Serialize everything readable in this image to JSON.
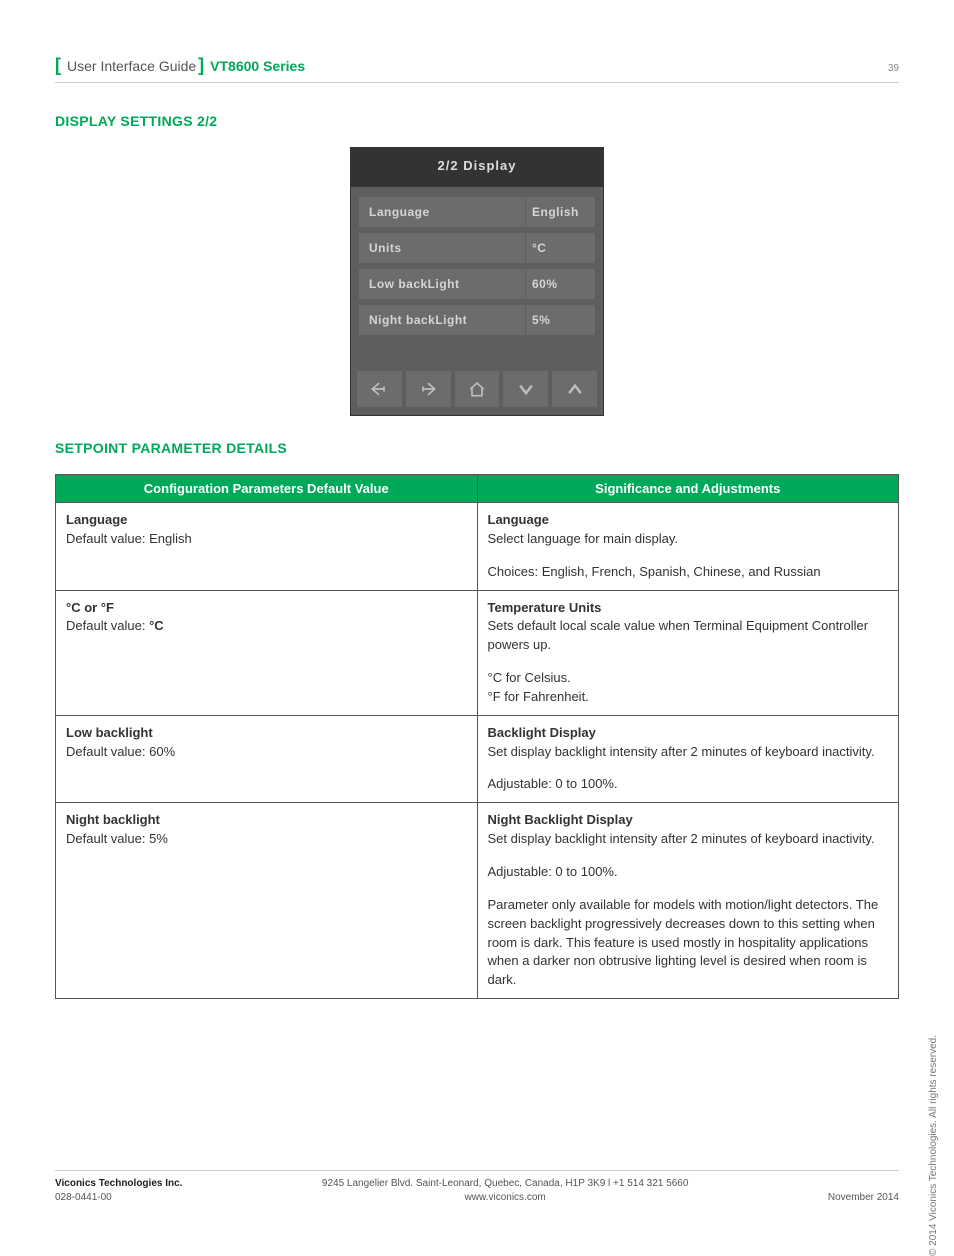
{
  "header": {
    "title": "User Interface Guide",
    "series": "VT8600 Series",
    "page_number": "39"
  },
  "section1_title": "DISPLAY SETTINGS 2/2",
  "device": {
    "title": "2/2 Display",
    "rows": [
      {
        "label": "Language",
        "value": "English"
      },
      {
        "label": "Units",
        "value": "°C"
      },
      {
        "label": "Low backLight",
        "value": "60%"
      },
      {
        "label": "Night backLight",
        "value": "5%"
      }
    ]
  },
  "section2_title": "SETPOINT PARAMETER DETAILS",
  "table": {
    "head1": "Configuration Parameters Default Value",
    "head2": "Significance and Adjustments",
    "rows": [
      {
        "left_title": "Language",
        "left_default": "Default value: English",
        "right_title": "Language",
        "right": [
          "Select language for main display.",
          "Choices: English, French, Spanish, Chinese, and Russian"
        ]
      },
      {
        "left_title": "°C or °F",
        "left_default_prefix": "Default value: ",
        "left_default_bold": "°C",
        "right_title": "Temperature Units",
        "right": [
          "Sets default local scale value when Terminal Equipment Controller powers up.",
          "°C for Celsius.\n°F for Fahrenheit."
        ]
      },
      {
        "left_title": "Low backlight",
        "left_default": "Default value: 60%",
        "right_title": "Backlight Display",
        "right": [
          "Set display backlight intensity after 2 minutes of keyboard inactivity.",
          "Adjustable: 0 to 100%."
        ]
      },
      {
        "left_title": "Night backlight",
        "left_default": "Default value: 5%",
        "right_title": "Night Backlight Display",
        "right": [
          "Set display backlight intensity after 2 minutes of keyboard inactivity.",
          "Adjustable: 0 to 100%.",
          "Parameter only available for models with motion/light detectors. The screen backlight progressively decreases down to this setting when\nroom is dark. This feature is used mostly in hospitality applications when a darker non obtrusive lighting level is desired when room is dark."
        ]
      }
    ]
  },
  "footer": {
    "company": "Viconics Technologies Inc.",
    "doc_no": "028-0441-00",
    "address": "9245 Langelier Blvd. Saint-Leonard, Quebec, Canada, H1P 3K9  l  +1 514 321 5660",
    "website": "www.viconics.com",
    "date": "November 2014"
  },
  "copyright": "© 2014 Viconics Technologies. All rights reserved."
}
